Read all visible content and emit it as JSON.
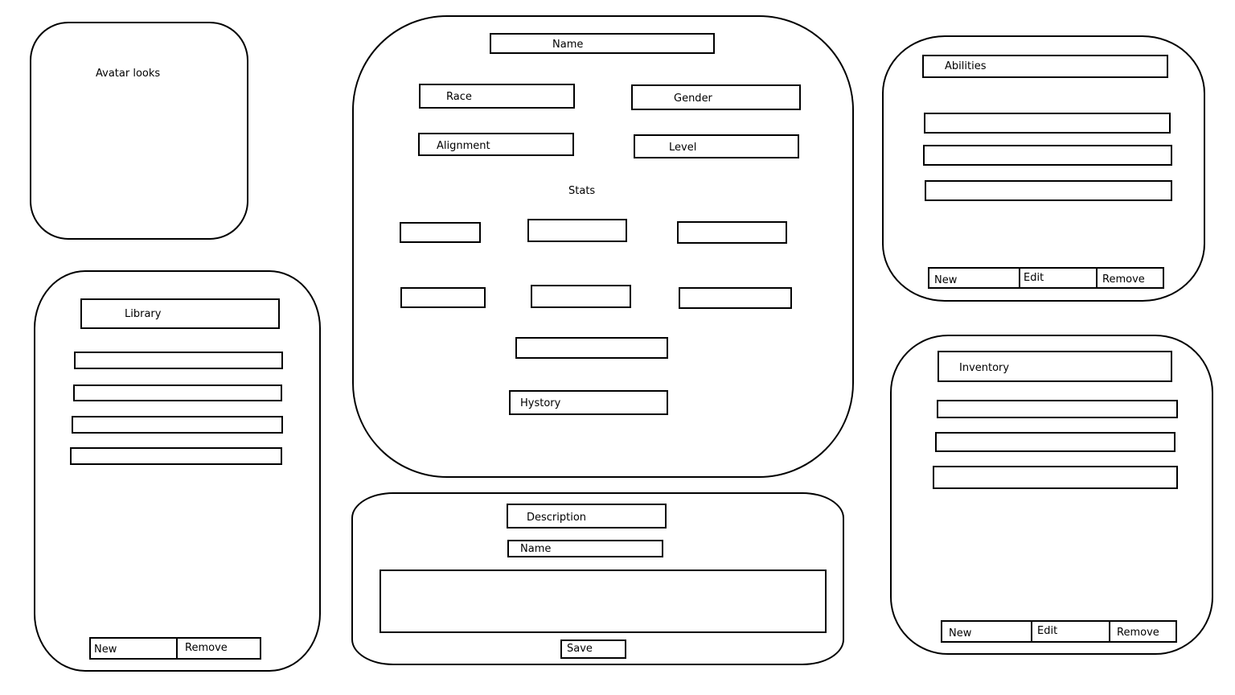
{
  "avatar": {
    "label": "Avatar looks"
  },
  "character": {
    "name_label": "Name",
    "race_label": "Race",
    "gender_label": "Gender",
    "alignment_label": "Alignment",
    "level_label": "Level",
    "stats_label": "Stats",
    "history_label": "Hystory"
  },
  "library": {
    "title": "Library",
    "new_label": "New",
    "remove_label": "Remove"
  },
  "abilities": {
    "title": "Abilities",
    "new_label": "New",
    "edit_label": "Edit",
    "remove_label": "Remove"
  },
  "inventory": {
    "title": "Inventory",
    "new_label": "New",
    "edit_label": "Edit",
    "remove_label": "Remove"
  },
  "description": {
    "title": "Description",
    "name_label": "Name",
    "save_label": "Save"
  }
}
